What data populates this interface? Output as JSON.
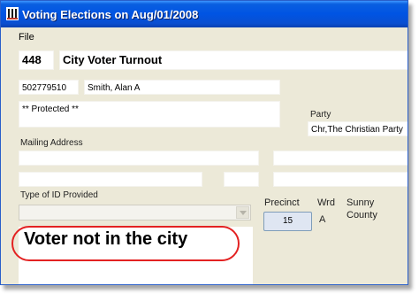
{
  "window": {
    "title": "Voting Elections on Aug/01/2008",
    "icon": "voting-app-icon"
  },
  "menu": {
    "items": [
      "File"
    ]
  },
  "record": {
    "number": "448",
    "name": "City Voter Turnout"
  },
  "voter": {
    "id": "502779510",
    "name": "Smith, Alan A",
    "address_line": "** Protected **"
  },
  "party": {
    "label": "Party",
    "value": "Chr,The Christian Party"
  },
  "mailing": {
    "label": "Mailing Address"
  },
  "id_type": {
    "label": "Type of ID Provided",
    "value": ""
  },
  "precinct": {
    "label": "Precinct",
    "value": "15"
  },
  "ward": {
    "label": "Wrd",
    "value": "A"
  },
  "county": {
    "line1": "Sunny",
    "line2": "County"
  },
  "annotation": {
    "text": "Voter not in the city",
    "color": "#e32222"
  }
}
